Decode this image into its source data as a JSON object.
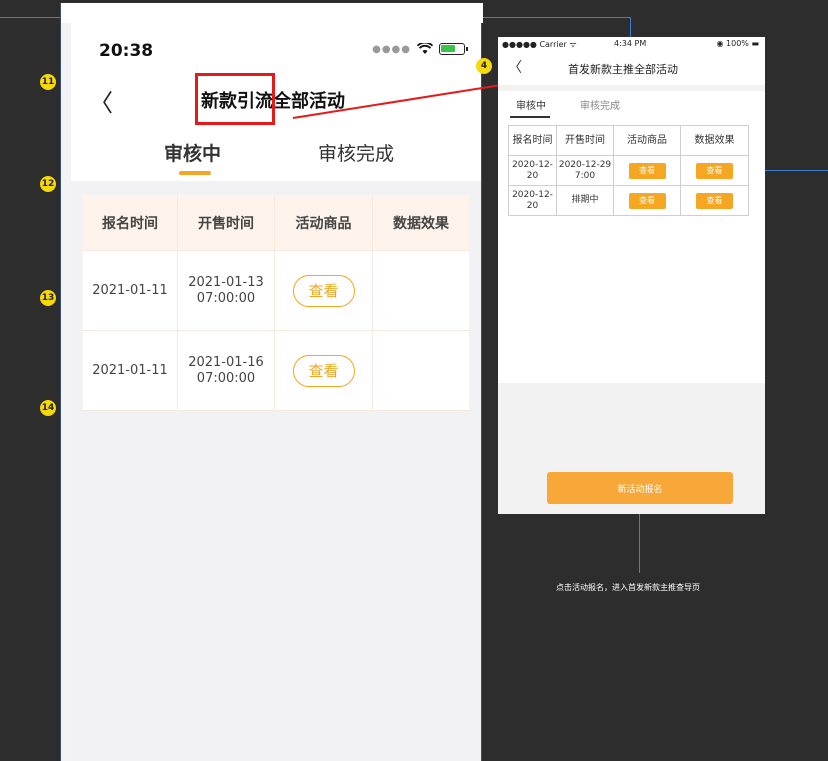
{
  "markers": [
    "11",
    "12",
    "13",
    "14"
  ],
  "left_phone": {
    "status_time": "20:38",
    "status_dots": "●●●●",
    "back_glyph": "〈",
    "title": "新款引流全部活动",
    "tabs": [
      "审核中",
      "审核完成"
    ],
    "table_headers": [
      "报名时间",
      "开售时间",
      "活动商品",
      "数据效果"
    ],
    "rows": [
      {
        "signup": "2021-01-11",
        "sale_date": "2021-01-13",
        "sale_time": "07:00:00",
        "action": "查看"
      },
      {
        "signup": "2021-01-11",
        "sale_date": "2021-01-16",
        "sale_time": "07:00:00",
        "action": "查看"
      }
    ]
  },
  "right_phone": {
    "carrier": "●●●●● Carrier ᯤ",
    "clock": "4:34 PM",
    "battery": "◉ 100% ▬",
    "back_glyph": "〈",
    "title": "首发新款主推全部活动",
    "tabs": [
      "审核中",
      "审核完成"
    ],
    "table_headers": [
      "报名时间",
      "开售时间",
      "活动商品",
      "数据效果"
    ],
    "rows": [
      {
        "signup_a": "2020-12-",
        "signup_b": "20",
        "sale_a": "2020-12-29",
        "sale_b": "7:00",
        "goods": "查看",
        "effect": "查看"
      },
      {
        "signup_a": "2020-12-",
        "signup_b": "20",
        "sale_a": "排期中",
        "sale_b": "",
        "goods": "查看",
        "effect": "查看"
      }
    ],
    "cta": "新活动报名"
  },
  "marker_clip": "4",
  "note": "点击活动报名，进入首发新款主推查导页",
  "colors": {
    "accent": "#f5a623",
    "highlight": "#e51b1b",
    "connector": "#3f7fd4"
  }
}
